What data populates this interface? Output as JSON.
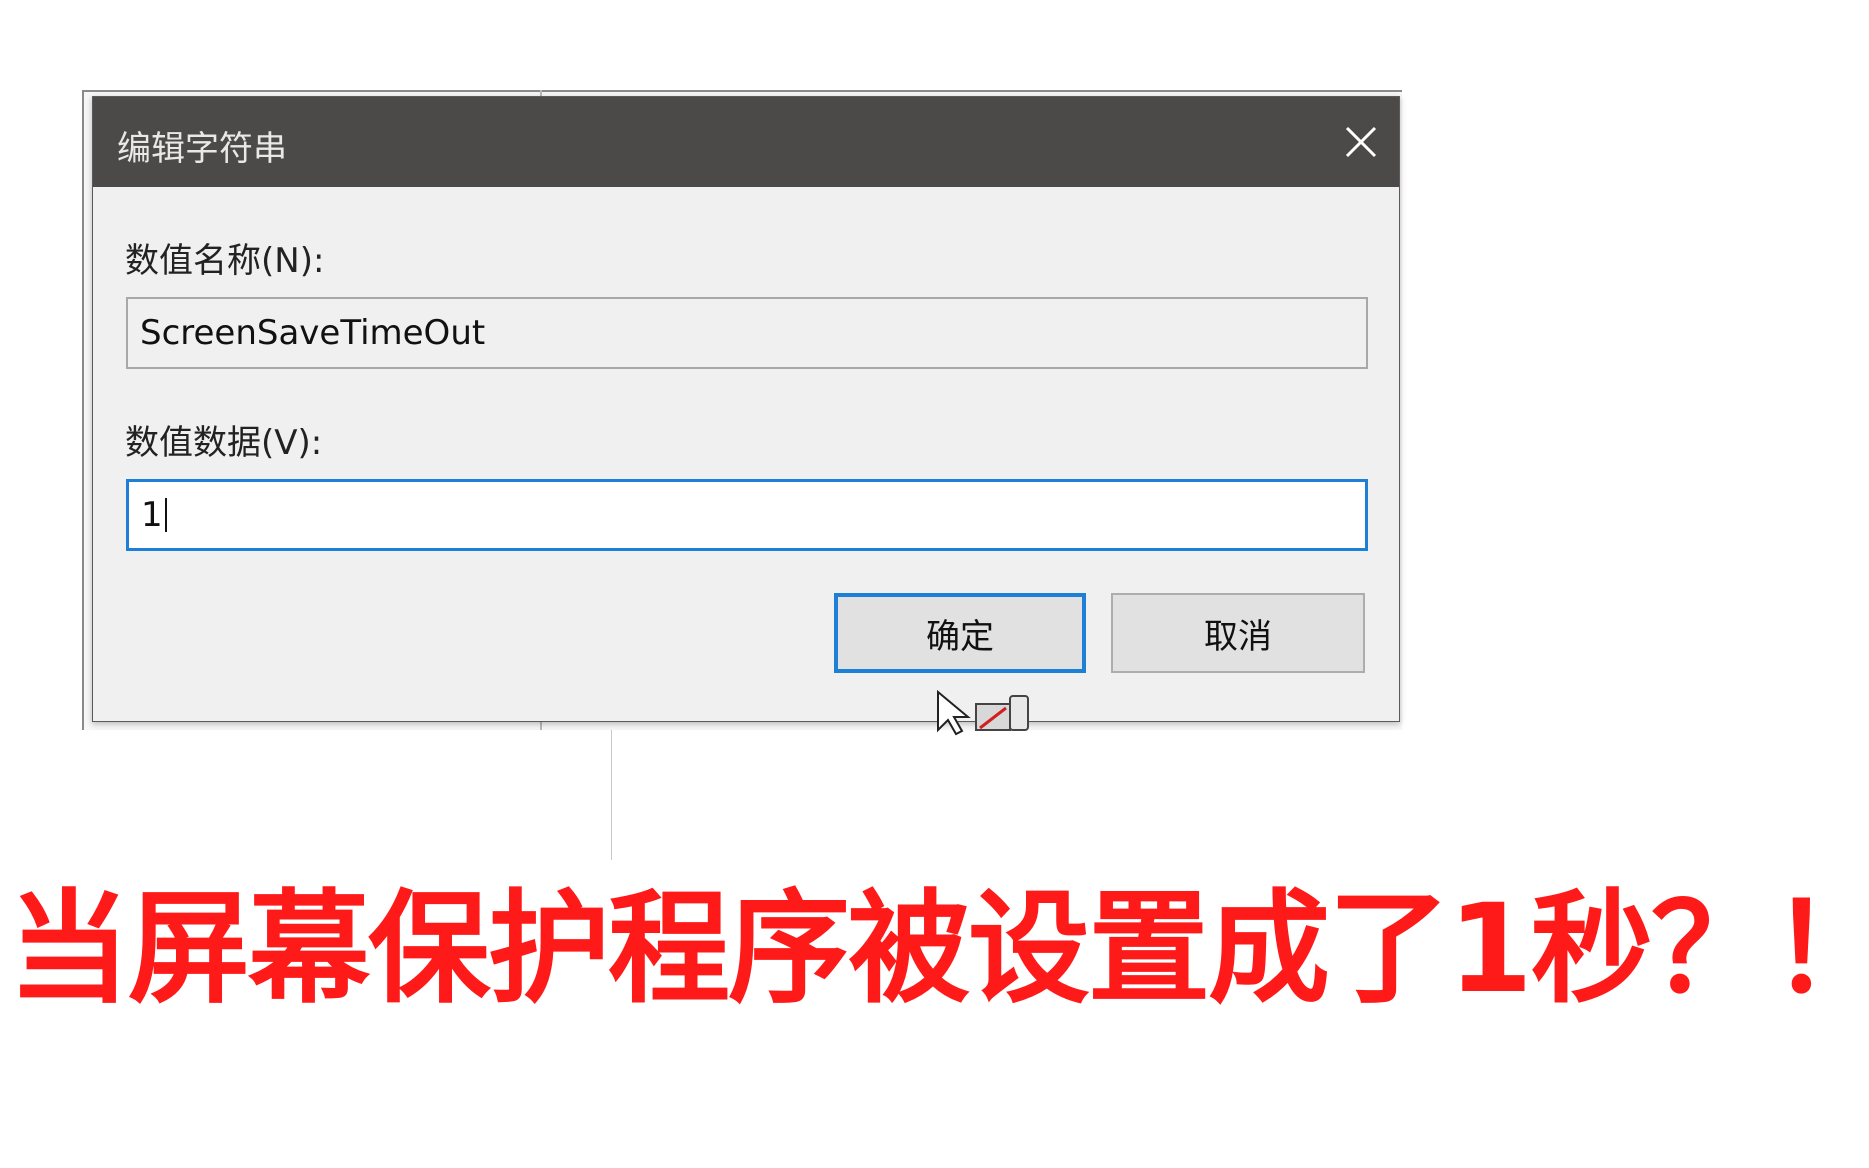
{
  "dialog": {
    "title": "编辑字符串",
    "close_icon": "close-icon",
    "value_name_label": "数值名称(N):",
    "value_name": "ScreenSaveTimeOut",
    "value_data_label": "数值数据(V):",
    "value_data": "1",
    "ok_label": "确定",
    "cancel_label": "取消"
  },
  "caption": "当屏幕保护程序被设置成了1秒？！",
  "colors": {
    "titlebar": "#4b4a48",
    "focus_border": "#1e7fd6",
    "caption": "#ff1a1a"
  }
}
